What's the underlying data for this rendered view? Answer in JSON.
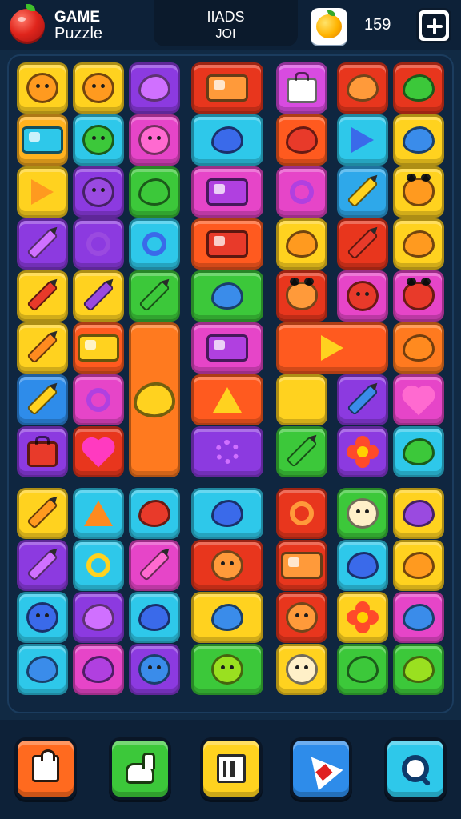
{
  "header": {
    "title_line1": "GAME",
    "title_line2": "Puzzle",
    "score_label": "ІІADS",
    "score_value": "ЈОІ",
    "coins": "159",
    "logo_icon": "apple-icon",
    "coin_icon": "orange-coin-icon",
    "menu_icon": "plus-menu-icon"
  },
  "board": {
    "columns": 8,
    "rows": 12,
    "tiles": [
      {
        "r": 0,
        "c": 0,
        "color": "#ffd21f",
        "icon": "cookie-face"
      },
      {
        "r": 0,
        "c": 1,
        "color": "#ffd21f",
        "icon": "bear-face"
      },
      {
        "r": 0,
        "c": 2,
        "color": "#8c3ae0",
        "icon": "candy"
      },
      {
        "r": 0,
        "c": 3,
        "color": "#e8361d",
        "icon": "printer",
        "span_c": 2
      },
      {
        "r": 0,
        "c": 5,
        "color": "#d84be0",
        "icon": "handbag"
      },
      {
        "r": 0,
        "c": 6,
        "color": "#e8361d",
        "icon": "tomato"
      },
      {
        "r": 0,
        "c": 7,
        "color": "#e8361d",
        "icon": "green-apple"
      },
      {
        "r": 1,
        "c": 0,
        "color": "#ffb21f",
        "icon": "folder"
      },
      {
        "r": 1,
        "c": 1,
        "color": "#2ec8ea",
        "icon": "green-bug"
      },
      {
        "r": 1,
        "c": 2,
        "color": "#e645c8",
        "icon": "pink-face"
      },
      {
        "r": 1,
        "c": 3,
        "color": "#2ec8ea",
        "icon": "plum",
        "span_c": 2
      },
      {
        "r": 1,
        "c": 5,
        "color": "#ff5a1f",
        "icon": "red-ball"
      },
      {
        "r": 1,
        "c": 6,
        "color": "#2ec8ea",
        "icon": "kite"
      },
      {
        "r": 1,
        "c": 7,
        "color": "#ffd21f",
        "icon": "blue-bean"
      },
      {
        "r": 2,
        "c": 0,
        "color": "#ffd21f",
        "icon": "arrow-tri"
      },
      {
        "r": 2,
        "c": 1,
        "color": "#8c3ae0",
        "icon": "purple-face"
      },
      {
        "r": 2,
        "c": 2,
        "color": "#3cc83a",
        "icon": "green-egg"
      },
      {
        "r": 2,
        "c": 3,
        "color": "#e645c8",
        "icon": "camera",
        "span_c": 2
      },
      {
        "r": 2,
        "c": 5,
        "color": "#e645c8",
        "icon": "ring"
      },
      {
        "r": 2,
        "c": 6,
        "color": "#2ea8ea",
        "icon": "pencil-yellow"
      },
      {
        "r": 2,
        "c": 7,
        "color": "#ffd21f",
        "icon": "monkey"
      },
      {
        "r": 3,
        "c": 0,
        "color": "#8c3ae0",
        "icon": "wand"
      },
      {
        "r": 3,
        "c": 1,
        "color": "#8c3ae0",
        "icon": "purple-ring"
      },
      {
        "r": 3,
        "c": 2,
        "color": "#2ec8ea",
        "icon": "donut"
      },
      {
        "r": 3,
        "c": 3,
        "color": "#ff5a1f",
        "icon": "camera-red",
        "span_c": 2
      },
      {
        "r": 3,
        "c": 5,
        "color": "#ffd21f",
        "icon": "lemon"
      },
      {
        "r": 3,
        "c": 6,
        "color": "#e8361d",
        "icon": "pencil-red"
      },
      {
        "r": 3,
        "c": 7,
        "color": "#ffd21f",
        "icon": "watermelon"
      },
      {
        "r": 4,
        "c": 0,
        "color": "#ffd21f",
        "icon": "crayon-red"
      },
      {
        "r": 4,
        "c": 1,
        "color": "#ffd21f",
        "icon": "crayon-purple"
      },
      {
        "r": 4,
        "c": 2,
        "color": "#3cc83a",
        "icon": "crayon-green"
      },
      {
        "r": 4,
        "c": 3,
        "color": "#3cc83a",
        "icon": "cloud-blue",
        "span_c": 2
      },
      {
        "r": 4,
        "c": 5,
        "color": "#e8361d",
        "icon": "cat"
      },
      {
        "r": 4,
        "c": 6,
        "color": "#e645c8",
        "icon": "bear-red"
      },
      {
        "r": 4,
        "c": 7,
        "color": "#e645c8",
        "icon": "cat-red"
      },
      {
        "r": 5,
        "c": 0,
        "color": "#ffd21f",
        "icon": "pencil-orange"
      },
      {
        "r": 5,
        "c": 1,
        "color": "#ff5a1f",
        "icon": "envelope"
      },
      {
        "r": 5,
        "c": 2,
        "color": "#ff7a1f",
        "icon": "lantern",
        "span_r": 3
      },
      {
        "r": 5,
        "c": 3,
        "color": "#e645c8",
        "icon": "cheese-box",
        "span_c": 2
      },
      {
        "r": 5,
        "c": 5,
        "color": "#ff5a1f",
        "icon": "paper-plane",
        "span_c": 2
      },
      {
        "r": 5,
        "c": 7,
        "color": "#ff7a1f",
        "icon": "orange"
      },
      {
        "r": 6,
        "c": 0,
        "color": "#2e8cea",
        "icon": "pencil-yellow"
      },
      {
        "r": 6,
        "c": 1,
        "color": "#e645c8",
        "icon": "target"
      },
      {
        "r": 6,
        "c": 3,
        "color": "#ff5a1f",
        "icon": "sun-star",
        "span_c": 2
      },
      {
        "r": 6,
        "c": 5,
        "color": "#ffd21f",
        "icon": "star-yellow"
      },
      {
        "r": 6,
        "c": 6,
        "color": "#8c3ae0",
        "icon": "pencil-blue"
      },
      {
        "r": 6,
        "c": 7,
        "color": "#e645c8",
        "icon": "heart-pink"
      },
      {
        "r": 7,
        "c": 0,
        "color": "#8c3ae0",
        "icon": "handbag-red"
      },
      {
        "r": 7,
        "c": 1,
        "color": "#e8361d",
        "icon": "heart-magenta"
      },
      {
        "r": 7,
        "c": 3,
        "color": "#8c3ae0",
        "icon": "gear",
        "span_c": 2
      },
      {
        "r": 7,
        "c": 5,
        "color": "#3cc83a",
        "icon": "crayon-green"
      },
      {
        "r": 7,
        "c": 6,
        "color": "#8c3ae0",
        "icon": "flower"
      },
      {
        "r": 7,
        "c": 7,
        "color": "#2ec8ea",
        "icon": "apple-green"
      },
      {
        "r": 8,
        "c": 0,
        "color": "#ffd21f",
        "icon": "lipstick"
      },
      {
        "r": 8,
        "c": 1,
        "color": "#2ec8ea",
        "icon": "star-orange"
      },
      {
        "r": 8,
        "c": 2,
        "color": "#2ec8ea",
        "icon": "apple-red"
      },
      {
        "r": 8,
        "c": 3,
        "color": "#2ec8ea",
        "icon": "bowl",
        "span_c": 2
      },
      {
        "r": 8,
        "c": 5,
        "color": "#e8361d",
        "icon": "swirl"
      },
      {
        "r": 8,
        "c": 6,
        "color": "#3cc83a",
        "icon": "cream-face"
      },
      {
        "r": 8,
        "c": 7,
        "color": "#ffd21f",
        "icon": "purple-blob"
      },
      {
        "r": 9,
        "c": 0,
        "color": "#8c3ae0",
        "icon": "bone"
      },
      {
        "r": 9,
        "c": 1,
        "color": "#2ec8ea",
        "icon": "yellow-ring"
      },
      {
        "r": 9,
        "c": 2,
        "color": "#e645c8",
        "icon": "crayon-pink"
      },
      {
        "r": 9,
        "c": 3,
        "color": "#e8361d",
        "icon": "ghost-face",
        "span_c": 2
      },
      {
        "r": 9,
        "c": 5,
        "color": "#e8361d",
        "icon": "robot-box"
      },
      {
        "r": 9,
        "c": 6,
        "color": "#2ec8ea",
        "icon": "magnifier"
      },
      {
        "r": 9,
        "c": 7,
        "color": "#ffd21f",
        "icon": "mango"
      },
      {
        "r": 10,
        "c": 0,
        "color": "#2ec8ea",
        "icon": "cookie"
      },
      {
        "r": 10,
        "c": 1,
        "color": "#8c3ae0",
        "icon": "peach"
      },
      {
        "r": 10,
        "c": 2,
        "color": "#2ec8ea",
        "icon": "macaron"
      },
      {
        "r": 10,
        "c": 3,
        "color": "#ffd21f",
        "icon": "blue-pill",
        "span_c": 2
      },
      {
        "r": 10,
        "c": 5,
        "color": "#e8361d",
        "icon": "lion"
      },
      {
        "r": 10,
        "c": 6,
        "color": "#ffd21f",
        "icon": "red-flower"
      },
      {
        "r": 10,
        "c": 7,
        "color": "#e645c8",
        "icon": "blue-blob"
      },
      {
        "r": 11,
        "c": 0,
        "color": "#2ec8ea",
        "icon": "blue-drop"
      },
      {
        "r": 11,
        "c": 1,
        "color": "#e645c8",
        "icon": "sushi"
      },
      {
        "r": 11,
        "c": 2,
        "color": "#8c3ae0",
        "icon": "blue-ghost"
      },
      {
        "r": 11,
        "c": 3,
        "color": "#3cc83a",
        "icon": "lime-face",
        "span_c": 2
      },
      {
        "r": 11,
        "c": 5,
        "color": "#ffd21f",
        "icon": "cream-face"
      },
      {
        "r": 11,
        "c": 6,
        "color": "#3cc83a",
        "icon": "green-leaf"
      },
      {
        "r": 11,
        "c": 7,
        "color": "#3cc83a",
        "icon": "lime"
      }
    ]
  },
  "footer": {
    "buttons": [
      {
        "name": "puzzle-piece-button",
        "icon": "puzzle-piece-icon",
        "color": "#ff6a1f"
      },
      {
        "name": "llama-button",
        "icon": "llama-icon",
        "color": "#3cc83a"
      },
      {
        "name": "cube-button",
        "icon": "cube-icon",
        "color": "#ffd21f"
      },
      {
        "name": "arrow-button",
        "icon": "arrow-icon",
        "color": "#2e8cea"
      },
      {
        "name": "search-button",
        "icon": "search-icon",
        "color": "#2ec8ea"
      }
    ]
  }
}
